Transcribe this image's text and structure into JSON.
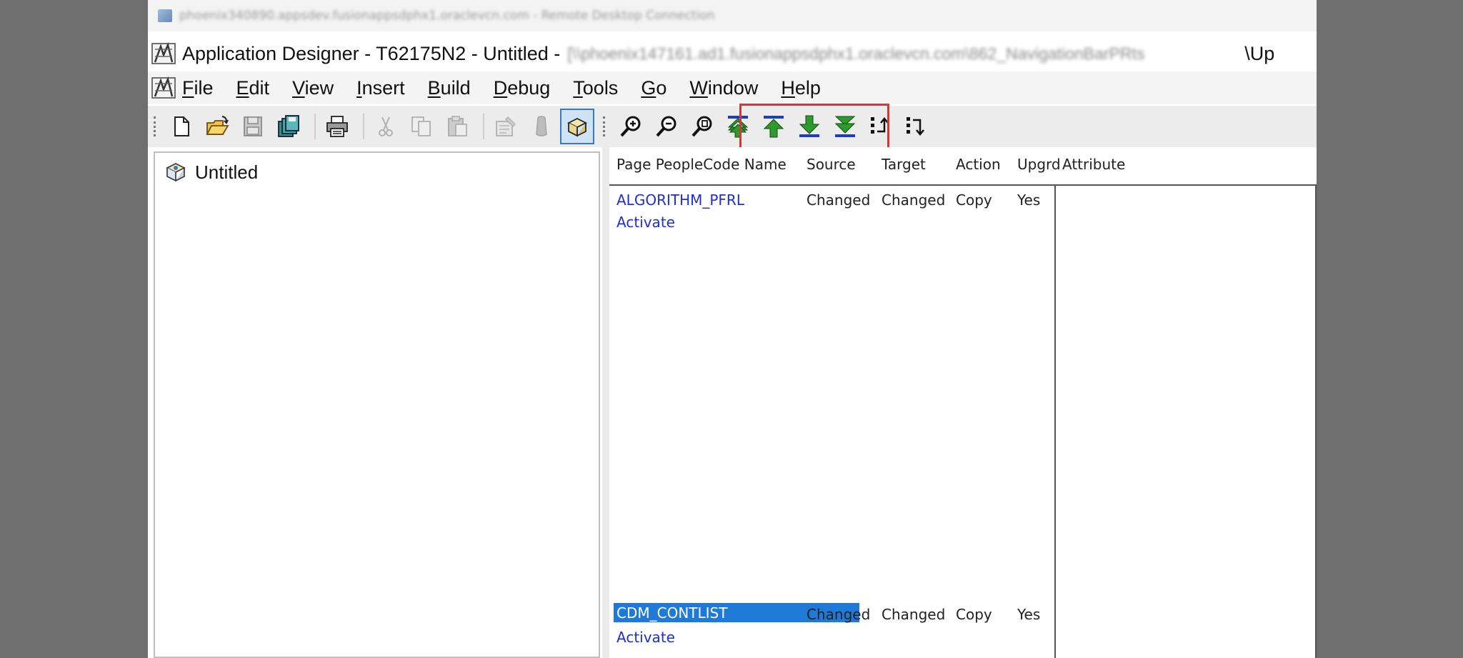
{
  "remote_desktop": {
    "title": "phoenix340890.appsdev.fusionappsdphx1.oraclevcn.com - Remote Desktop Connection"
  },
  "app": {
    "title": "Application Designer - T62175N2 - Untitled -",
    "title_blurred": "[\\\\phoenix147161.ad1.fusionappsdphx1.oraclevcn.com\\862_NavigationBarPRts",
    "title_tail": "\\Up"
  },
  "menu": [
    {
      "label": "File",
      "mnemonic": "F",
      "rest": "ile"
    },
    {
      "label": "Edit",
      "mnemonic": "E",
      "rest": "dit"
    },
    {
      "label": "View",
      "mnemonic": "V",
      "rest": "iew"
    },
    {
      "label": "Insert",
      "mnemonic": "I",
      "rest": "nsert"
    },
    {
      "label": "Build",
      "mnemonic": "B",
      "rest": "uild"
    },
    {
      "label": "Debug",
      "mnemonic": "D",
      "rest": "ebug"
    },
    {
      "label": "Tools",
      "mnemonic": "T",
      "rest": "ools"
    },
    {
      "label": "Go",
      "mnemonic": "G",
      "rest": "o"
    },
    {
      "label": "Window",
      "mnemonic": "W",
      "rest": "indow"
    },
    {
      "label": "Help",
      "mnemonic": "H",
      "rest": "elp"
    }
  ],
  "toolbar": {
    "icons": [
      "new-icon",
      "open-icon",
      "save-icon",
      "save-all-icon",
      "print-icon",
      "cut-icon",
      "copy-icon",
      "paste-icon",
      "properties-icon",
      "find-icon",
      "toggle-project-icon",
      "zoom-in-icon",
      "zoom-out-icon",
      "find-definition-icon",
      "move-to-top-icon",
      "move-up-icon",
      "move-down-icon",
      "move-to-bottom-icon",
      "previous-upgrade-icon",
      "next-upgrade-icon"
    ],
    "highlight_color": "#cc3b3b"
  },
  "tree": {
    "root_label": "Untitled"
  },
  "list": {
    "headers": [
      "Page PeopleCode Name",
      "Source",
      "Target",
      "Action",
      "Upgrd",
      "Attribute"
    ],
    "rows": [
      {
        "name": "ALGORITHM_PFRL",
        "event": "Activate",
        "source": "Changed",
        "target": "Changed",
        "action": "Copy",
        "upgrade": "Yes",
        "attribute": "",
        "selected": false
      },
      {
        "name": "CDM_CONTLIST",
        "event": "Activate",
        "source": "Changed",
        "target": "Changed",
        "action": "Copy",
        "upgrade": "Yes",
        "attribute": "",
        "selected": true
      }
    ]
  },
  "colors": {
    "link": "#1f2fd0",
    "selection": "#1e7ad6",
    "arrow_green": "#2e9a2e",
    "arrow_blue": "#1f3fb8"
  }
}
